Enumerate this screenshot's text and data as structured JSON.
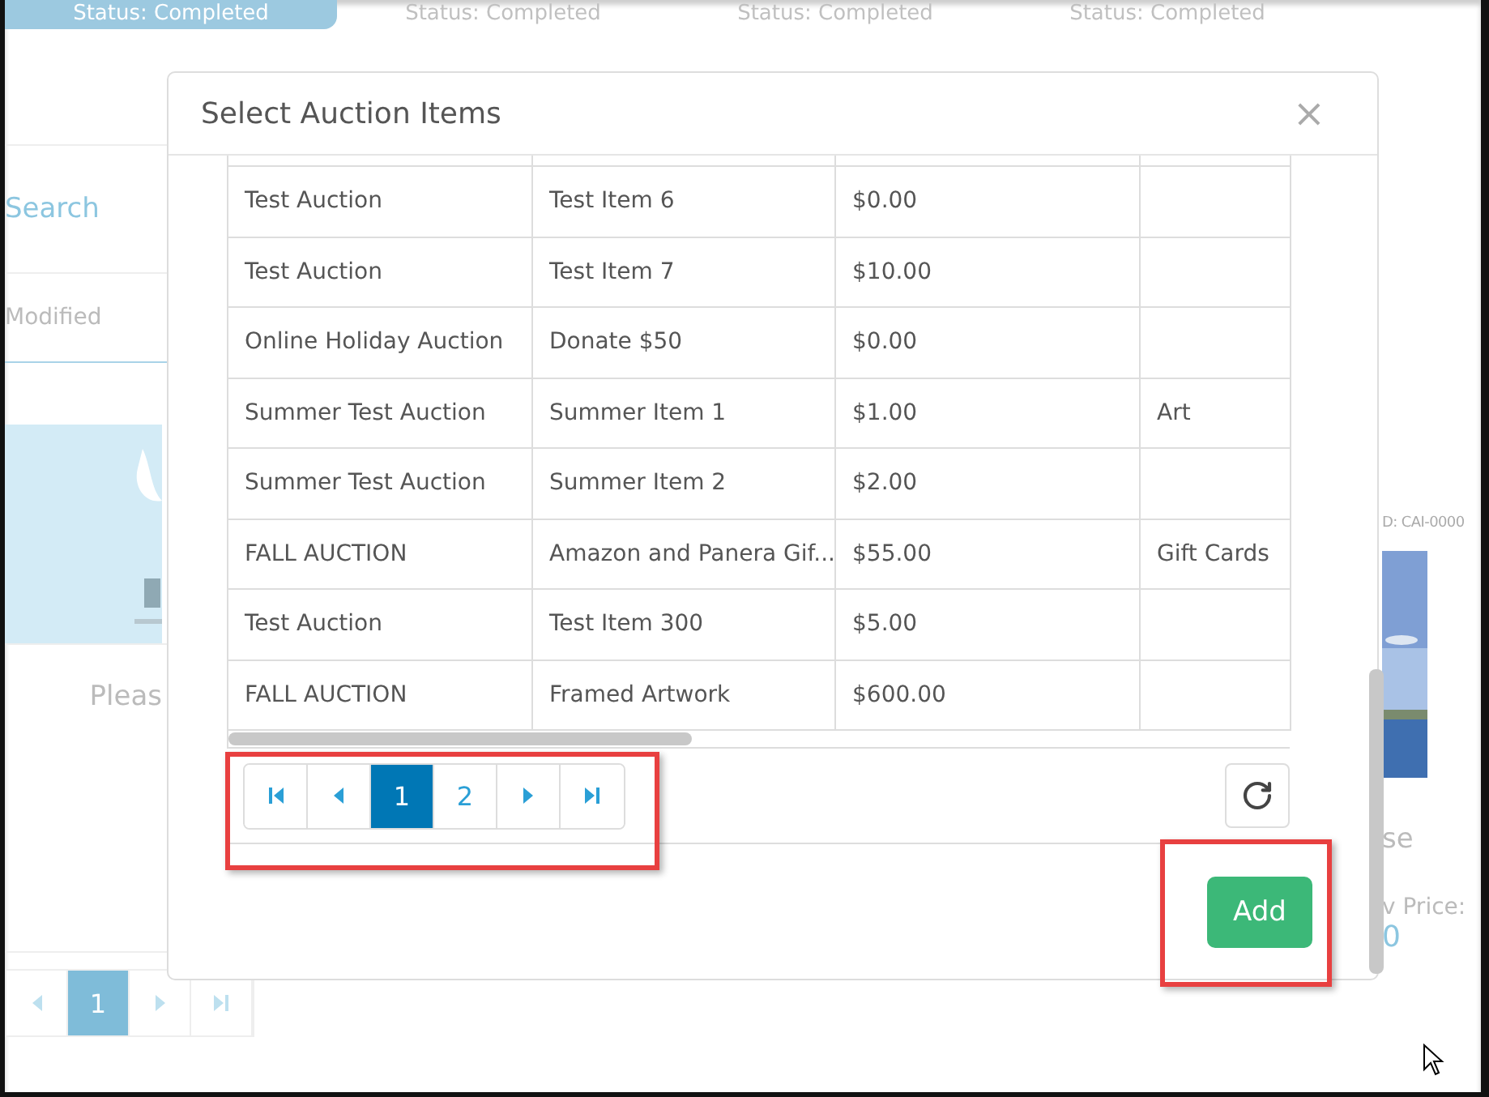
{
  "background_page": {
    "steps": [
      {
        "label": "Status: Completed",
        "selected": true
      },
      {
        "label": "Status: Completed",
        "selected": false
      },
      {
        "label": "Status: Completed",
        "selected": false
      },
      {
        "label": "Status: Completed",
        "selected": false
      }
    ],
    "search_link": "Search",
    "column_label": "Modified",
    "left_card": {
      "caption": "Pleas"
    },
    "right_card": {
      "id": "D: CAI-0000",
      "caption": "se",
      "price_label": "v Price:",
      "price": "0"
    },
    "pagination": [
      {
        "label": "1",
        "selected": true
      }
    ]
  },
  "dialog": {
    "title": "Select Auction Items",
    "close": "×",
    "rows": [
      {
        "auction": "Test Auction",
        "item": "Test Item 6",
        "price": "$0.00"
      },
      {
        "auction": "Test Auction",
        "item": "Test Item 7",
        "price": "$10.00"
      },
      {
        "auction": "Online Holiday Auction",
        "item": "Donate $50",
        "price": "$0.00"
      },
      {
        "auction": "Summer Test Auction",
        "item": "Summer Item 1",
        "price": "$1.00",
        "column_4": "Art"
      },
      {
        "auction": "Summer Test Auction",
        "item": "Summer Item 2",
        "price": "$2.00"
      },
      {
        "auction": "FALL AUCTION",
        "item": "Amazon and Panera Gif...",
        "price": "$55.00",
        "column_4": "Gift Cards"
      },
      {
        "auction": "Test Auction",
        "item": "Test Item 300",
        "price": "$5.00"
      },
      {
        "auction": "FALL AUCTION",
        "item": "Framed Artwork",
        "price": "$600.00"
      }
    ],
    "pages": [
      {
        "label": "1",
        "selected": true
      },
      {
        "label": "2",
        "selected": false
      }
    ],
    "add_button": "Add"
  }
}
